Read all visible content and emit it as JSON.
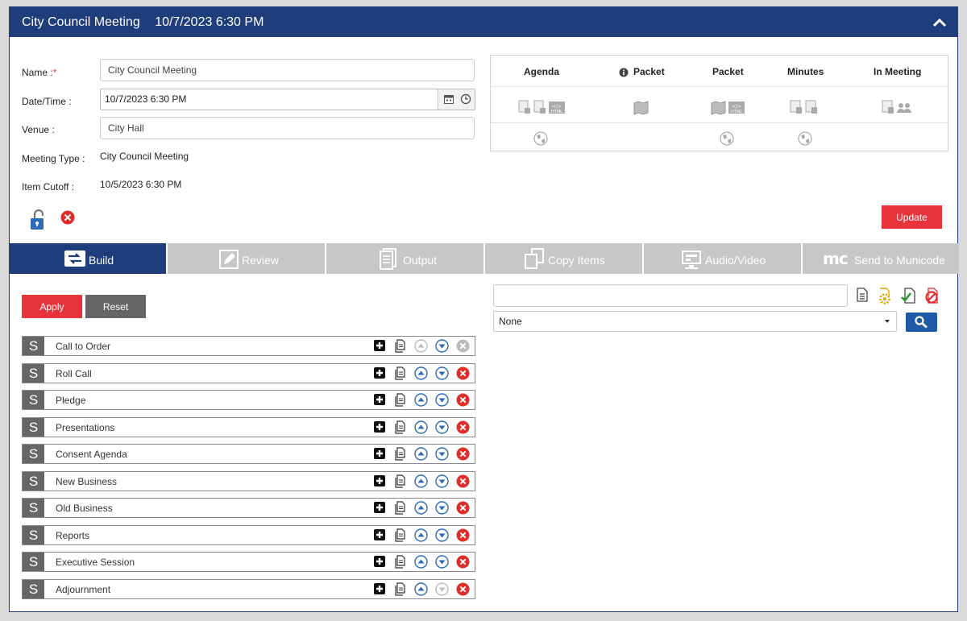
{
  "header": {
    "title": "City Council Meeting",
    "datetime": "10/7/2023 6:30 PM"
  },
  "form": {
    "name_label": "Name :",
    "name_required_mark": "*",
    "name_value": "City Council Meeting",
    "datetime_label": "Date/Time :",
    "datetime_value": "10/7/2023 6:30 PM",
    "venue_label": "Venue :",
    "venue_value": "City Hall",
    "meeting_type_label": "Meeting Type :",
    "meeting_type_value": "City Council Meeting",
    "item_cutoff_label": "Item Cutoff :",
    "item_cutoff_value": "10/5/2023 6:30 PM",
    "update_label": "Update"
  },
  "publish_grid": {
    "columns": [
      "Agenda",
      "Packet",
      "Packet",
      "Minutes",
      "In Meeting"
    ]
  },
  "tabs": [
    {
      "label": "Build",
      "icon": "build-icon",
      "active": true
    },
    {
      "label": "Review",
      "icon": "pencil-icon",
      "active": false
    },
    {
      "label": "Output",
      "icon": "document-stack-icon",
      "active": false
    },
    {
      "label": "Copy Items",
      "icon": "copy-icon",
      "active": false
    },
    {
      "label": "Audio/Video",
      "icon": "audio-video-icon",
      "active": false
    },
    {
      "label": "Send to Municode",
      "icon": "mc-logo-icon",
      "active": false
    }
  ],
  "build": {
    "apply_label": "Apply",
    "reset_label": "Reset",
    "section_badge": "S",
    "sections": [
      "Call to Order",
      "Roll Call",
      "Pledge",
      "Presentations",
      "Consent Agenda",
      "New Business",
      "Old Business",
      "Reports",
      "Executive Session",
      "Adjournment"
    ]
  },
  "search": {
    "text_value": "",
    "filter_value": "None"
  },
  "colors": {
    "primary": "#1f3d7a",
    "danger": "#e8333b",
    "neutral": "#666666",
    "tab_inactive": "#c7c7c7"
  }
}
